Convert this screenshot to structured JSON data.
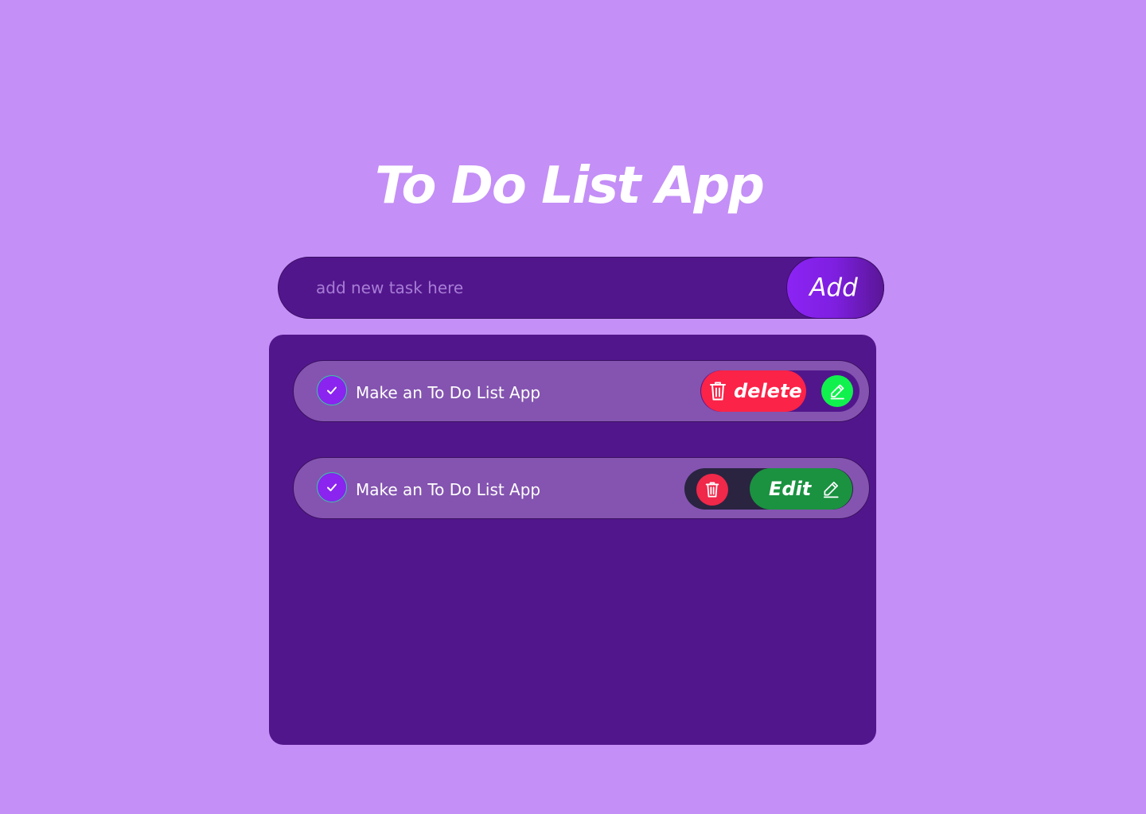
{
  "app": {
    "title": "To Do List App"
  },
  "new_task": {
    "placeholder": "add new task here",
    "value": "",
    "add_label": "Add"
  },
  "tasks": [
    {
      "text": "Make an To Do List App",
      "delete_label": "delete"
    },
    {
      "text": "Make an To Do List App",
      "edit_label": "Edit"
    }
  ],
  "colors": {
    "background": "#c48ff6",
    "panel": "#52168c",
    "task_row": "#8454b0",
    "delete": "#fb2347",
    "edit_green": "#10f14e",
    "edit_dark_green": "#1a9240",
    "check": "#8a24ee"
  },
  "icons": [
    "check-icon",
    "trash-icon",
    "pencil-icon"
  ]
}
